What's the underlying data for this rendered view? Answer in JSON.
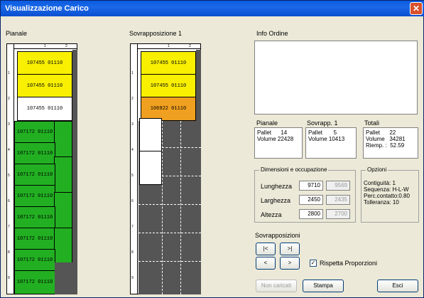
{
  "window": {
    "title": "Visualizzazione Carico",
    "close_glyph": "✕"
  },
  "panels": {
    "pianale": "Pianale",
    "sovrapposizione": "Sovrapposizione 1",
    "info": "Info Ordine"
  },
  "ruler": {
    "top": [
      "1",
      "2"
    ],
    "rows": [
      "1",
      "2",
      "3",
      "4",
      "5",
      "6",
      "7",
      "8",
      "9"
    ]
  },
  "pianale_cells": {
    "yellow": "107455 01110",
    "white": "107455 01110",
    "green": "107172 01110"
  },
  "sovrapp_cells": {
    "yellow": "107455 01110",
    "orange": "106922 01110"
  },
  "stats": {
    "pianale": {
      "title": "Pianale",
      "l1": "Pallet      14",
      "l2": "Volume 22428"
    },
    "sovrapp": {
      "title": "Sovrapp. 1",
      "l1": "Pallet       5",
      "l2": "Volume 10413"
    },
    "totali": {
      "title": "Totali",
      "l1": "Pallet      22",
      "l2": "Volume   34281",
      "l3": "Riemp. :  52.59"
    }
  },
  "dims": {
    "title": "Dimensioni e occupazione",
    "lung": "Lunghezza",
    "larg": "Larghezza",
    "alt": "Altezza",
    "v1": "9710",
    "v2": "9569",
    "v3": "2450",
    "v4": "2435",
    "v5": "2800",
    "v6": "2700"
  },
  "opzioni": {
    "title": "Opzioni",
    "l1": "Contiguità: 1",
    "l2": "Sequenza: H-L-W",
    "l3": "Perc.contatto:0.80",
    "l4": "Tolleranza: 10"
  },
  "sovr": {
    "title": "Sovrapposizioni",
    "first": "|<",
    "last": ">|",
    "prev": "<",
    "next": ">",
    "chk": "✓",
    "rispetta": "Rispetta Proporzioni"
  },
  "buttons": {
    "noncaricati": "Non caricati",
    "stampa": "Stampa",
    "esci": "Esci"
  },
  "colors": {
    "yellow": "#f8f000",
    "green": "#22b022",
    "orange": "#f0a020",
    "gray": "#555555"
  }
}
